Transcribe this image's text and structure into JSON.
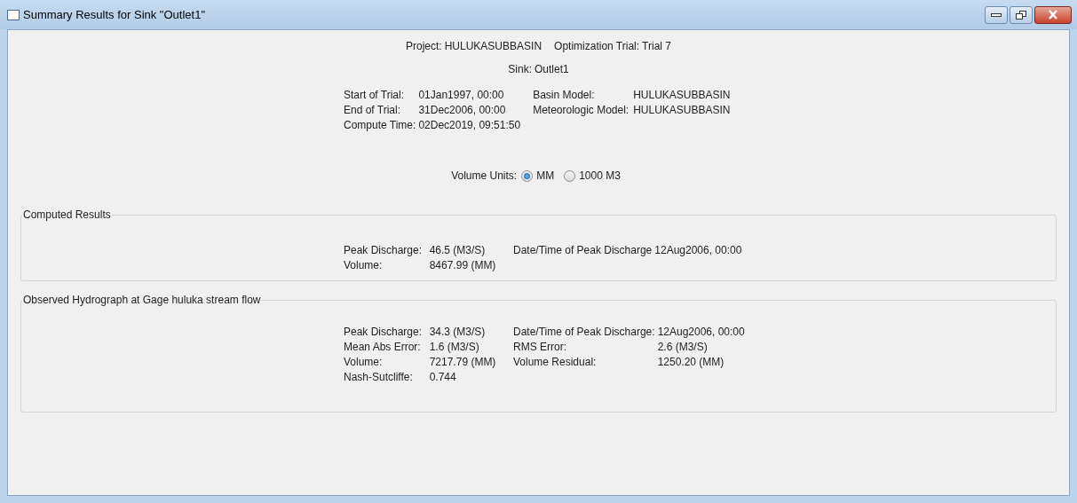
{
  "window": {
    "title": "Summary Results for Sink \"Outlet1\""
  },
  "header": {
    "line_1": [
      {
        "label": "Project:",
        "value": "HULUKASUBBASIN"
      },
      {
        "label": "Optimization Trial:",
        "value": "Trial 7"
      }
    ],
    "line_2": {
      "label": "Sink:",
      "value": "Outlet1"
    },
    "info_left": [
      {
        "label": "Start of Trial:",
        "value": "01Jan1997, 00:00"
      },
      {
        "label": "End of Trial:",
        "value": "31Dec2006, 00:00"
      },
      {
        "label": "Compute Time:",
        "value": "02Dec2019, 09:51:50"
      }
    ],
    "info_right": [
      {
        "label": "Basin Model:",
        "value": "HULUKASUBBASIN"
      },
      {
        "label": "Meteorologic Model:",
        "value": "HULUKASUBBASIN"
      }
    ]
  },
  "volume_units": {
    "label": "Volume Units:",
    "options": [
      {
        "label": "MM",
        "selected": true
      },
      {
        "label": "1000 M3",
        "selected": false
      }
    ]
  },
  "sections": [
    {
      "title": "Computed Results",
      "left": [
        {
          "label": "Peak Discharge:",
          "value": "46.5 (M3/S)"
        },
        {
          "label": "Volume:",
          "value": "8467.99 (MM)"
        }
      ],
      "right": [
        {
          "label": "Date/Time of Peak Discharge",
          "value": "12Aug2006, 00:00"
        }
      ]
    },
    {
      "title": "Observed Hydrograph at Gage huluka stream flow",
      "left": [
        {
          "label": "Peak Discharge:",
          "value": "34.3 (M3/S)"
        },
        {
          "label": "Mean Abs Error:",
          "value": "1.6 (M3/S)"
        },
        {
          "label": "Volume:",
          "value": "7217.79 (MM)"
        },
        {
          "label": "Nash-Sutcliffe:",
          "value": "0.744"
        }
      ],
      "right": [
        {
          "label": "Date/Time of Peak Discharge:",
          "value": "12Aug2006, 00:00"
        },
        {
          "label": "RMS Error:",
          "value": "2.6 (M3/S)"
        },
        {
          "label": "Volume Residual:",
          "value": "1250.20 (MM)"
        }
      ]
    }
  ]
}
